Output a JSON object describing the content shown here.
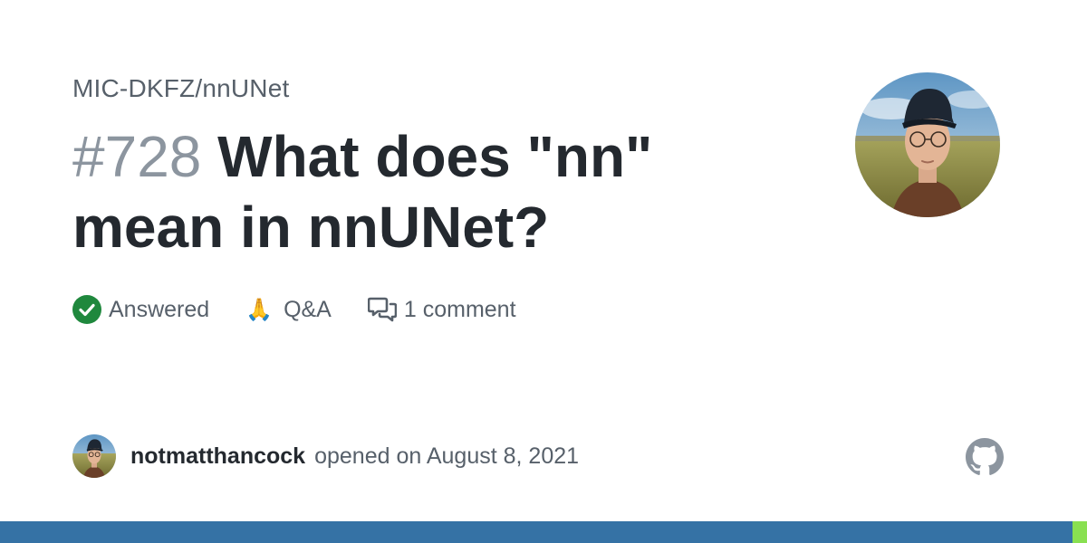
{
  "repo": "MIC-DKFZ/nnUNet",
  "issue": {
    "number": "#728",
    "title": "What does \"nn\" mean in nnUNet?"
  },
  "meta": {
    "status": "Answered",
    "category_emoji": "🙏",
    "category": "Q&A",
    "comments": "1 comment"
  },
  "author": {
    "username": "notmatthancock",
    "opened": "opened on August 8, 2021"
  },
  "colors": {
    "language_bar": "#3572a5",
    "language_accent": "#89e051",
    "answered_green": "#1f883d"
  },
  "icons": [
    "check-circle-icon",
    "comment-discussion-icon",
    "github-logo-icon"
  ]
}
